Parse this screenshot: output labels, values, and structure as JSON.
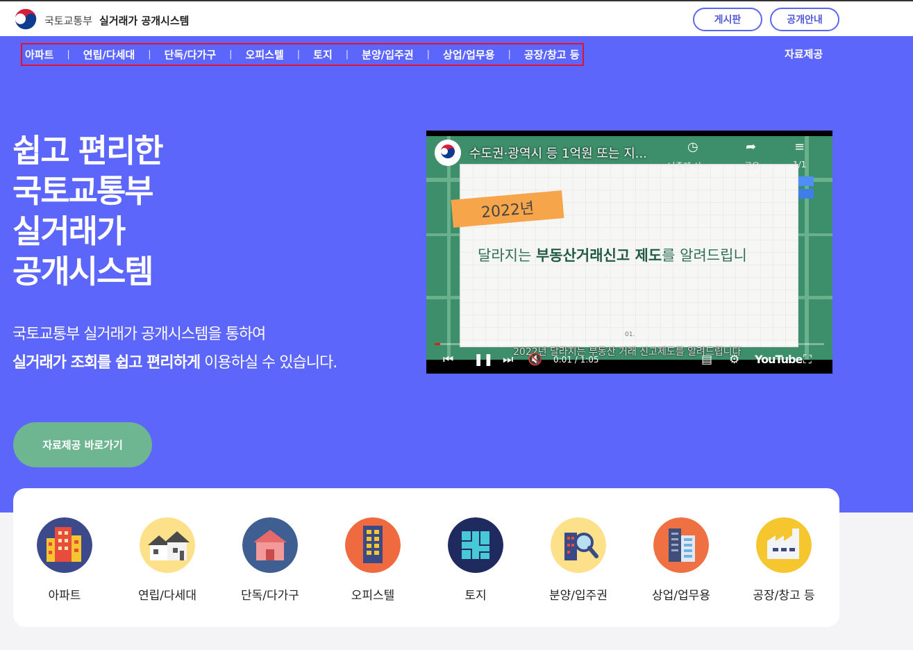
{
  "header": {
    "org": "국토교통부",
    "system": "실거래가 공개시스템",
    "buttons": {
      "board": "게시판",
      "guide": "공개안내"
    }
  },
  "gnb": {
    "items": [
      "아파트",
      "연립/다세대",
      "단독/다가구",
      "오피스텔",
      "토지",
      "분양/입주권",
      "상업/업무용",
      "공장/창고 등"
    ],
    "extra": "자료제공"
  },
  "hero": {
    "title": [
      "쉽고 편리한",
      "국토교통부",
      "실거래가",
      "공개시스템"
    ],
    "desc1": "국토교통부 실거래가 공개시스템을 통하여",
    "desc2_bold": "실거래가 조회를 쉽고 편리하게",
    "desc2_rest": " 이용하실 수 있습니다.",
    "cta": "자료제공 바로가기"
  },
  "video": {
    "title": "수도권·광역시 등 1억원 또는 지...",
    "tag": "2022년",
    "headline_pre": "달라지는 ",
    "headline_bold": "부동산거래신고 제도",
    "headline_post": "를 알려드립니",
    "slide_number": "01.",
    "watch_later": "나중에 시...",
    "share": "공유",
    "playlist": "1/1",
    "caption": "2022년 달라지는 부동산 거래 신고제도를 알려드립니다",
    "time": "0:01 / 1:05",
    "progress": 0.015,
    "brand": "YouTube"
  },
  "categories": [
    {
      "label": "아파트",
      "icon": "apartment-icon",
      "color": "#3c4a8c"
    },
    {
      "label": "연립/다세대",
      "icon": "row-house-icon",
      "color": "#fde08a"
    },
    {
      "label": "단독/다가구",
      "icon": "detached-house-icon",
      "color": "#3f5f93"
    },
    {
      "label": "오피스텔",
      "icon": "officetel-icon",
      "color": "#ef6a3e"
    },
    {
      "label": "토지",
      "icon": "land-icon",
      "color": "#1f2a5e"
    },
    {
      "label": "분양/입주권",
      "icon": "presale-icon",
      "color": "#fde08a"
    },
    {
      "label": "상업/업무용",
      "icon": "commercial-icon",
      "color": "#ef7043"
    },
    {
      "label": "공장/창고 등",
      "icon": "factory-icon",
      "color": "#f6c62e"
    }
  ],
  "colors": {
    "hero_bg": "#5d66fa",
    "cta_bg": "#6eb592",
    "highlight": "#e2122c"
  }
}
